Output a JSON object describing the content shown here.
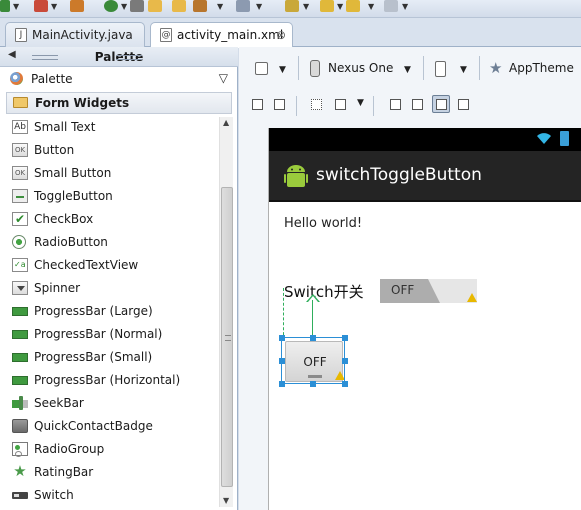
{
  "tabs": [
    {
      "label": "MainActivity.java",
      "icon": "java-file-icon",
      "active": false
    },
    {
      "label": "activity_main.xml",
      "icon": "xml-file-icon",
      "active": true,
      "close": "⊗"
    }
  ],
  "palette": {
    "header_title": "Palette",
    "selector_label": "Palette",
    "category": "Form Widgets",
    "items": [
      {
        "label": "Small Text",
        "icon": "text-icon",
        "glyph": "Ab"
      },
      {
        "label": "Button",
        "icon": "button-icon",
        "glyph": "OK"
      },
      {
        "label": "Small Button",
        "icon": "small-button-icon",
        "glyph": "OK"
      },
      {
        "label": "ToggleButton",
        "icon": "toggle-button-icon"
      },
      {
        "label": "CheckBox",
        "icon": "checkbox-icon",
        "glyph": "✔"
      },
      {
        "label": "RadioButton",
        "icon": "radio-button-icon"
      },
      {
        "label": "CheckedTextView",
        "icon": "checked-text-view-icon",
        "glyph": "✓a"
      },
      {
        "label": "Spinner",
        "icon": "spinner-icon"
      },
      {
        "label": "ProgressBar (Large)",
        "icon": "progressbar-icon"
      },
      {
        "label": "ProgressBar (Normal)",
        "icon": "progressbar-icon"
      },
      {
        "label": "ProgressBar (Small)",
        "icon": "progressbar-icon"
      },
      {
        "label": "ProgressBar (Horizontal)",
        "icon": "progressbar-icon"
      },
      {
        "label": "SeekBar",
        "icon": "seekbar-icon"
      },
      {
        "label": "QuickContactBadge",
        "icon": "quick-contact-badge-icon"
      },
      {
        "label": "RadioGroup",
        "icon": "radio-group-icon"
      },
      {
        "label": "RatingBar",
        "icon": "star-icon",
        "glyph": "★"
      },
      {
        "label": "Switch",
        "icon": "switch-icon"
      }
    ]
  },
  "device_toolbar": {
    "device": "Nexus One",
    "theme": "AppTheme"
  },
  "preview": {
    "app_title": "switchToggleButton",
    "hello_text": "Hello world!",
    "switch_label": "Switch开关",
    "switch_state": "OFF",
    "toggle_text": "OFF"
  },
  "colors": {
    "action_bar": "#242424",
    "status_bar": "#000000",
    "selection": "#2b8fd6",
    "guide": "#2fae5c",
    "warning": "#e8b800"
  }
}
